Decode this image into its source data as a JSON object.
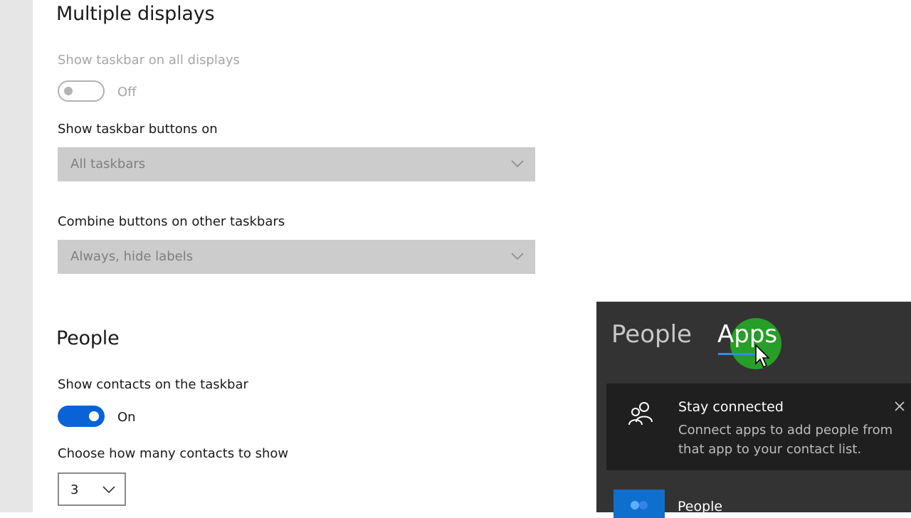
{
  "multiple_displays": {
    "heading": "Multiple displays",
    "show_taskbar_all": {
      "label": "Show taskbar on all displays",
      "state": "Off",
      "on": false
    },
    "buttons_on": {
      "label": "Show taskbar buttons on",
      "value": "All taskbars"
    },
    "combine_other": {
      "label": "Combine buttons on other taskbars",
      "value": "Always, hide labels"
    }
  },
  "people": {
    "heading": "People",
    "show_contacts": {
      "label": "Show contacts on the taskbar",
      "state": "On",
      "on": true
    },
    "how_many": {
      "label": "Choose how many contacts to show",
      "value": "3"
    }
  },
  "flyout": {
    "tabs": [
      "People",
      "Apps"
    ],
    "active_tab": "Apps",
    "card": {
      "title": "Stay connected",
      "body": "Connect apps to add people from that app to your contact list."
    },
    "app_item": "People"
  },
  "colors": {
    "accent": "#0a63d6",
    "flyout_bg": "#333333",
    "card_bg": "#1f1f1f",
    "disabled_dropdown": "#cccccc",
    "cursor_halo": "#26aa26"
  },
  "icons": {
    "chevron": "chevron-down-icon",
    "people": "people-icon",
    "close": "close-icon",
    "cursor": "mouse-cursor-icon"
  }
}
